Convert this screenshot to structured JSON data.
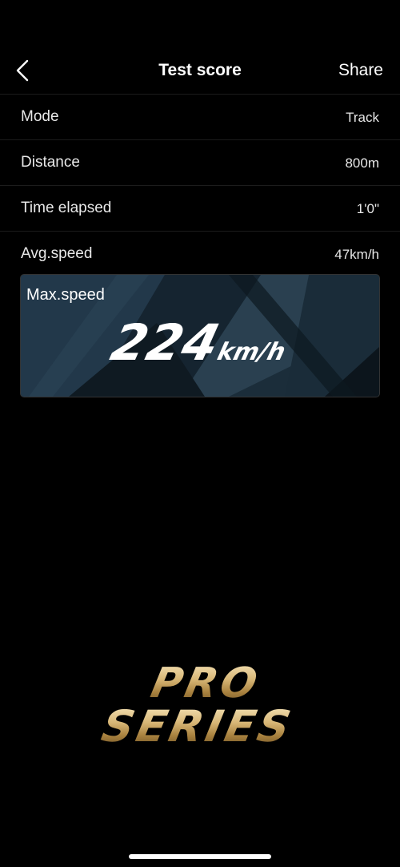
{
  "nav": {
    "title": "Test score",
    "share_label": "Share",
    "back_icon": "chevron-left-icon"
  },
  "stats": [
    {
      "label": "Mode",
      "value": "Track"
    },
    {
      "label": "Distance",
      "value": "800m"
    },
    {
      "label": "Time elapsed",
      "value": "1'0\""
    },
    {
      "label": "Avg.speed",
      "value": "47km/h"
    }
  ],
  "max_speed": {
    "label": "Max.speed",
    "value": "224",
    "unit": "km/h"
  },
  "logo": {
    "line1": "PRO",
    "line2": "SERIES"
  },
  "colors": {
    "background": "#000000",
    "card": "#1a2a36",
    "gold": "#c9a460"
  }
}
